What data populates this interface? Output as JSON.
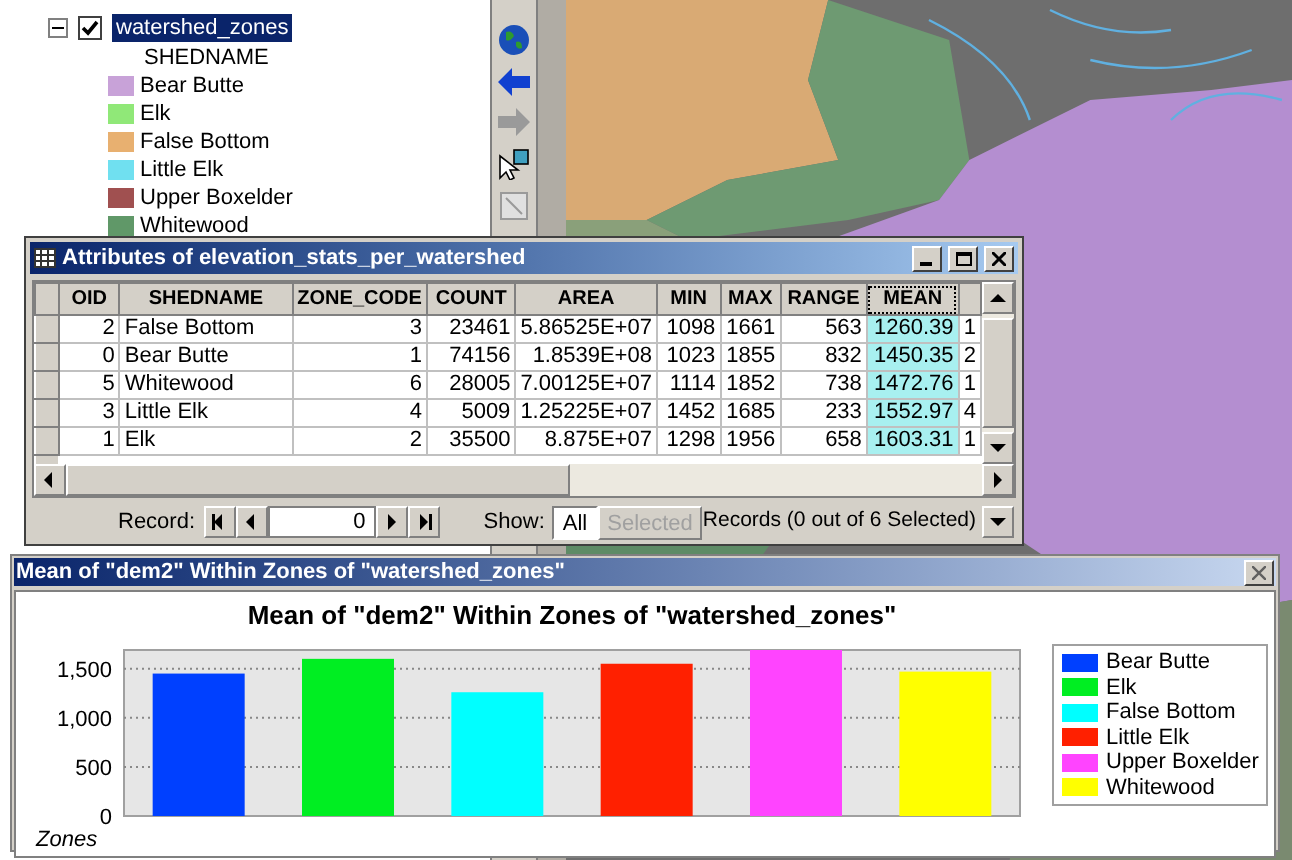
{
  "toc": {
    "layer": {
      "name": "watershed_zones",
      "expanded": true,
      "checked": true,
      "selected": true,
      "field": "SHEDNAME",
      "classes": [
        {
          "label": "Bear Butte",
          "color": "#c8a2d8"
        },
        {
          "label": "Elk",
          "color": "#90e878"
        },
        {
          "label": "False Bottom",
          "color": "#e8b070"
        },
        {
          "label": "Little Elk",
          "color": "#70e0f0"
        },
        {
          "label": "Upper Boxelder",
          "color": "#a05050"
        },
        {
          "label": "Whitewood",
          "color": "#609868"
        }
      ]
    }
  },
  "attribute_window": {
    "title": "Attributes of elevation_stats_per_watershed",
    "columns": [
      {
        "label": "OID",
        "selected": false
      },
      {
        "label": "SHEDNAME",
        "selected": false
      },
      {
        "label": "ZONE_CODE",
        "selected": false
      },
      {
        "label": "COUNT",
        "selected": false
      },
      {
        "label": "AREA",
        "selected": false
      },
      {
        "label": "MIN",
        "selected": false
      },
      {
        "label": "MAX",
        "selected": false
      },
      {
        "label": "RANGE",
        "selected": false
      },
      {
        "label": "MEAN",
        "selected": true
      },
      {
        "selected": false
      }
    ],
    "rows": [
      {
        "cells": [
          "2",
          "False Bottom",
          "3",
          "23461",
          "5.86525E+07",
          "1098",
          "1661",
          "563",
          "1260.39",
          "1"
        ]
      },
      {
        "cells": [
          "0",
          "Bear Butte",
          "1",
          "74156",
          "1.8539E+08",
          "1023",
          "1855",
          "832",
          "1450.35",
          "2"
        ]
      },
      {
        "cells": [
          "5",
          "Whitewood",
          "6",
          "28005",
          "7.00125E+07",
          "1114",
          "1852",
          "738",
          "1472.76",
          "1"
        ]
      },
      {
        "cells": [
          "3",
          "Little Elk",
          "4",
          "5009",
          "1.25225E+07",
          "1452",
          "1685",
          "233",
          "1552.97",
          "4"
        ]
      },
      {
        "cells": [
          "1",
          "Elk",
          "2",
          "35500",
          "8.875E+07",
          "1298",
          "1956",
          "658",
          "1603.31",
          "1"
        ]
      }
    ],
    "record_label": "Record:",
    "record_value": "0",
    "show_label": "Show:",
    "show_options": [
      {
        "label": "All",
        "selected": true,
        "disabled": false
      },
      {
        "label": "Selected",
        "selected": false,
        "disabled": true
      }
    ],
    "status": "Records (0 out of 6 Selected)"
  },
  "chart_window": {
    "title": "Mean of \"dem2\" Within Zones of \"watershed_zones\"",
    "chart_data": {
      "type": "bar",
      "grid": true,
      "legend": "right",
      "title": "Mean of \"dem2\" Within Zones of \"watershed_zones\"",
      "xlabel": "Zones",
      "ylim": [
        0,
        1690
      ],
      "yticks": [
        0,
        500,
        {
          "value": 1000,
          "label": "1,000"
        },
        {
          "value": 1500,
          "label": "1,500"
        }
      ],
      "series": [
        {
          "name": "Bear Butte",
          "color": "#0040ff",
          "values": [
            1450
          ]
        },
        {
          "name": "Elk",
          "color": "#00ee22",
          "values": [
            1600
          ]
        },
        {
          "name": "False Bottom",
          "color": "#00ffff",
          "values": [
            1260
          ]
        },
        {
          "name": "Little Elk",
          "color": "#ff2000",
          "values": [
            1550
          ]
        },
        {
          "name": "Upper Boxelder",
          "color": "#ff44ff",
          "values": [
            1690
          ]
        },
        {
          "name": "Whitewood",
          "color": "#ffff00",
          "values": [
            1470
          ]
        }
      ]
    }
  }
}
